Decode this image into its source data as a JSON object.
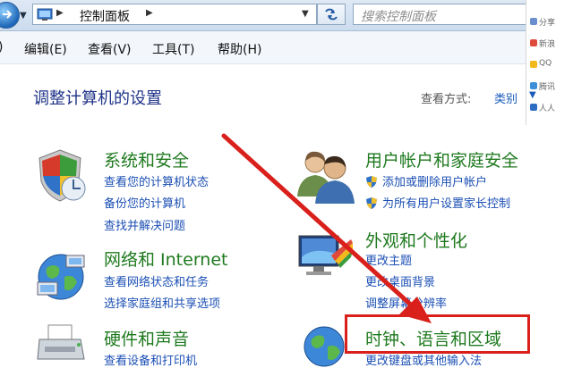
{
  "address_bar": {
    "path_label": "控制面板",
    "search_placeholder": "搜索控制面板"
  },
  "menu": {
    "partial_left": ")",
    "items": [
      "编辑(E)",
      "查看(V)",
      "工具(T)",
      "帮助(H)"
    ]
  },
  "side_panel": {
    "entries": [
      "分享",
      "新浪",
      "QQ",
      "腾讯",
      "人人"
    ]
  },
  "header": {
    "title": "调整计算机的设置",
    "view_label": "查看方式:",
    "view_value": "类别"
  },
  "categories": {
    "system_security": {
      "title": "系统和安全",
      "links": [
        "查看您的计算机状态",
        "备份您的计算机",
        "查找并解决问题"
      ]
    },
    "network": {
      "title": "网络和 Internet",
      "links": [
        "查看网络状态和任务",
        "选择家庭组和共享选项"
      ]
    },
    "hardware": {
      "title": "硬件和声音",
      "links": [
        "查看设备和打印机"
      ]
    },
    "user_accounts": {
      "title": "用户帐户和家庭安全",
      "links": [
        "添加或删除用户帐户",
        "为所有用户设置家长控制"
      ]
    },
    "appearance": {
      "title": "外观和个性化",
      "links": [
        "更改主题",
        "更改桌面背景",
        "调整屏幕分辨率"
      ]
    },
    "clock_region": {
      "title": "时钟、语言和区域",
      "links": [
        "更改键盘或其他输入法"
      ]
    }
  },
  "annotation": {
    "color": "#d9201b"
  }
}
